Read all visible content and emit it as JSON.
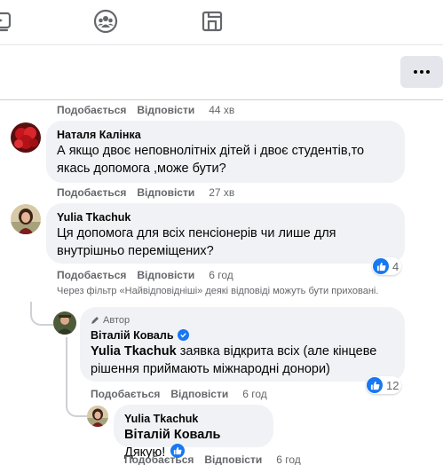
{
  "nav": {
    "icons": [
      "video-icon",
      "groups-icon",
      "gaming-icon"
    ]
  },
  "comments": [
    {
      "actions": {
        "like": "Подобається",
        "reply": "Відповісти",
        "time": "44 хв"
      }
    },
    {
      "author": "Наталя Калінка",
      "text_line1": "А якщо двоє неповнолітніх дітей і двоє студентів,то",
      "text_line2": "якась допомога ,може бути?",
      "actions": {
        "like": "Подобається",
        "reply": "Відповісти",
        "time": "27 хв"
      }
    },
    {
      "author": "Yulia Tkachuk",
      "text_line1": "Ця допомога для всіх пенсіонерів чи лише для",
      "text_line2": "внутрішньо переміщених?",
      "reaction_count": "4",
      "actions": {
        "like": "Подобається",
        "reply": "Відповісти",
        "time": "6 год"
      }
    }
  ],
  "filter_note": "Через фільтр «Найвідповідніші» деякі відповіді можуть бути приховані.",
  "replies": [
    {
      "badge": "Автор",
      "author": "Віталій Коваль",
      "mention": "Yulia Tkachuk",
      "text_line1": " заявка відкрита всіх (але кінцеве",
      "text_line2": "рішення приймають міжнародні донори)",
      "reaction_count": "12",
      "actions": {
        "like": "Подобається",
        "reply": "Відповісти",
        "time": "6 год"
      }
    },
    {
      "author": "Yulia Tkachuk",
      "mention": "Віталій Коваль",
      "text": " Дякую!",
      "actions": {
        "like": "Подобається",
        "reply": "Відповісти",
        "time": "6 год"
      }
    }
  ],
  "colors": {
    "accent": "#1877f2",
    "bubble": "#f0f2f5",
    "secondary_text": "#65676b"
  }
}
